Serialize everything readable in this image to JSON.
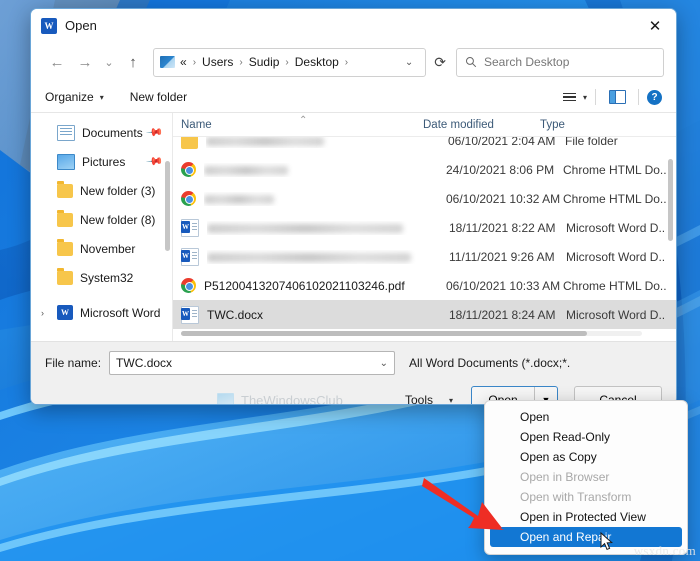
{
  "window": {
    "title": "Open",
    "app_icon": "word-icon",
    "close_label": "✕"
  },
  "nav": {
    "back": "←",
    "forward": "→",
    "recent": "⌄",
    "up": "↑",
    "refresh": "⟳",
    "address_chevron": "⌄",
    "breadcrumbs": [
      "«",
      "Users",
      "Sudip",
      "Desktop"
    ],
    "separator": "›",
    "search_placeholder": "Search Desktop",
    "search_icon": "search-icon"
  },
  "commandbar": {
    "organize": "Organize",
    "new_folder": "New folder",
    "caret": "▾",
    "view_icon": "view-list-icon",
    "preview_icon": "preview-pane-icon",
    "help_icon": "?"
  },
  "tree": {
    "items": [
      {
        "label": "Documents",
        "icon": "documents-icon",
        "pinned": true,
        "expandable": false
      },
      {
        "label": "Pictures",
        "icon": "pictures-icon",
        "pinned": true,
        "expandable": false
      },
      {
        "label": "New folder (3)",
        "icon": "folder-icon",
        "pinned": false,
        "expandable": false
      },
      {
        "label": "New folder (8)",
        "icon": "folder-icon",
        "pinned": false,
        "expandable": false
      },
      {
        "label": "November",
        "icon": "folder-icon",
        "pinned": false,
        "expandable": false
      },
      {
        "label": "System32",
        "icon": "folder-icon",
        "pinned": false,
        "expandable": false
      },
      {
        "label": "Microsoft Word",
        "icon": "word-icon",
        "pinned": false,
        "expandable": true
      }
    ],
    "pin_glyph": "📌",
    "chevron": "›"
  },
  "filelist": {
    "columns": [
      "Name",
      "Date modified",
      "Type"
    ],
    "sort_caret": "⌃",
    "rows": [
      {
        "name": "",
        "redacted": true,
        "redact_width": 118,
        "date": "06/10/2021 2:04 AM",
        "type": "File folder",
        "icon": "folder-icon",
        "selected": false
      },
      {
        "name": "",
        "redacted": true,
        "redact_width": 84,
        "date": "24/10/2021 8:06 PM",
        "type": "Chrome HTML Do..",
        "icon": "chrome-icon",
        "selected": false
      },
      {
        "name": "",
        "redacted": true,
        "redact_width": 70,
        "date": "06/10/2021 10:32 AM",
        "type": "Chrome HTML Do..",
        "icon": "chrome-icon",
        "selected": false
      },
      {
        "name": "",
        "redacted": true,
        "redact_width": 196,
        "date": "18/11/2021 8:22 AM",
        "type": "Microsoft Word D..",
        "icon": "word-doc-icon",
        "selected": false
      },
      {
        "name": "",
        "redacted": true,
        "redact_width": 204,
        "date": "11/11/2021 9:26 AM",
        "type": "Microsoft Word D..",
        "icon": "word-doc-icon",
        "selected": false
      },
      {
        "name": "P51200413207406102021103246.pdf",
        "redacted": false,
        "redact_width": 0,
        "date": "06/10/2021 10:33 AM",
        "type": "Chrome HTML Do..",
        "icon": "chrome-icon",
        "selected": false
      },
      {
        "name": "TWC.docx",
        "redacted": false,
        "redact_width": 0,
        "date": "18/11/2021 8:24 AM",
        "type": "Microsoft Word D..",
        "icon": "word-doc-icon",
        "selected": true
      }
    ]
  },
  "footer": {
    "file_name_label": "File name:",
    "file_name_value": "TWC.docx",
    "file_type_value": "All Word Documents (*.docx;*. ",
    "chevron": "⌄",
    "tools_label": "Tools",
    "tools_caret": "▾",
    "open_label": "Open",
    "open_caret": "▼",
    "cancel_label": "Cancel",
    "watermark": "TheWindowsClub"
  },
  "menu": {
    "items": [
      {
        "label": "Open",
        "state": "normal"
      },
      {
        "label": "Open Read-Only",
        "state": "normal"
      },
      {
        "label": "Open as Copy",
        "state": "normal"
      },
      {
        "label": "Open in Browser",
        "state": "disabled"
      },
      {
        "label": "Open with Transform",
        "state": "disabled"
      },
      {
        "label": "Open in Protected View",
        "state": "normal"
      },
      {
        "label": "Open and Repair",
        "state": "highlighted"
      }
    ]
  },
  "overlay": {
    "site_watermark": "wsxdn.com",
    "arrow_color": "#ee2d24"
  },
  "colors": {
    "accent": "#1277d3",
    "window_border": "#6aa6d8",
    "footer_bg": "#f0f0f0",
    "selection": "#dcdcdc",
    "wallpaper_blue": "#0b63c9"
  }
}
